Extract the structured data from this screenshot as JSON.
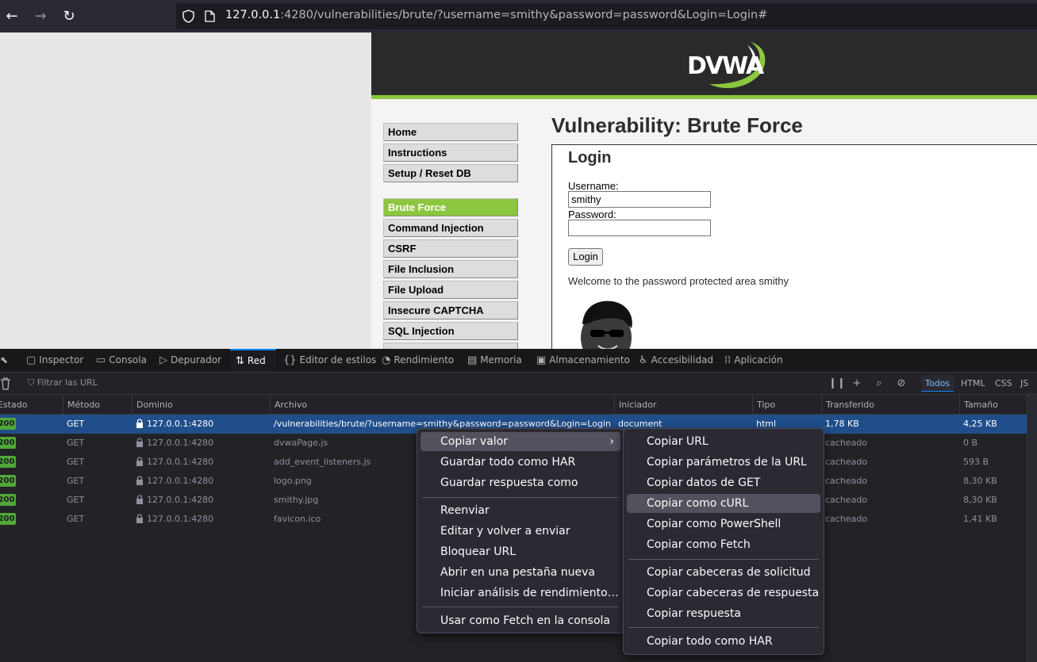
{
  "browser": {
    "url_host": "127.0.0.1",
    "url_rest": ":4280/vulnerabilities/brute/?username=smithy&password=password&Login=Login#"
  },
  "dvwa": {
    "logo_text": "DVWA",
    "menu": [
      "Home",
      "Instructions",
      "Setup / Reset DB",
      "Brute Force",
      "Command Injection",
      "CSRF",
      "File Inclusion",
      "File Upload",
      "Insecure CAPTCHA",
      "SQL Injection"
    ],
    "active_menu": "Brute Force",
    "title": "Vulnerability: Brute Force",
    "login_heading": "Login",
    "username_label": "Username:",
    "username_value": "smithy",
    "password_label": "Password:",
    "password_value": "",
    "login_button": "Login",
    "welcome": "Welcome to the password protected area smithy"
  },
  "devtools": {
    "tabs": [
      "Inspector",
      "Consola",
      "Depurador",
      "Red",
      "Editor de estilos",
      "Rendimiento",
      "Memoria",
      "Almacenamiento",
      "Accesibilidad",
      "Aplicación"
    ],
    "active_tab": "Red",
    "filter_placeholder": "Filtrar las URL",
    "type_filters": [
      "Todos",
      "HTML",
      "CSS",
      "JS"
    ],
    "columns": [
      "Estado",
      "Método",
      "Dominio",
      "Archivo",
      "Iniciador",
      "Tipo",
      "Transferido",
      "Tamaño"
    ],
    "rows": [
      {
        "status": "200",
        "method": "GET",
        "domain": "127.0.0.1:4280",
        "file": "/vulnerabilities/brute/?username=smithy&password=password&Login=Login",
        "initiator": "document",
        "type": "html",
        "transferred": "1,78 KB",
        "size": "4,25 KB"
      },
      {
        "status": "200",
        "method": "GET",
        "domain": "127.0.0.1:4280",
        "file": "dvwaPage.js",
        "initiator": "",
        "type": "",
        "transferred": "cacheado",
        "size": "0 B"
      },
      {
        "status": "200",
        "method": "GET",
        "domain": "127.0.0.1:4280",
        "file": "add_event_listeners.js",
        "initiator": "",
        "type": "",
        "transferred": "cacheado",
        "size": "593 B"
      },
      {
        "status": "200",
        "method": "GET",
        "domain": "127.0.0.1:4280",
        "file": "logo.png",
        "initiator": "",
        "type": "",
        "transferred": "cacheado",
        "size": "8,30 KB"
      },
      {
        "status": "200",
        "method": "GET",
        "domain": "127.0.0.1:4280",
        "file": "smithy.jpg",
        "initiator": "",
        "type": "",
        "transferred": "cacheado",
        "size": "8,30 KB"
      },
      {
        "status": "200",
        "method": "GET",
        "domain": "127.0.0.1:4280",
        "file": "favicon.ico",
        "initiator": "",
        "type": "",
        "transferred": "cacheado",
        "size": "1,41 KB"
      }
    ]
  },
  "context_menu": {
    "items": [
      "Copiar valor",
      "Guardar todo como HAR",
      "Guardar respuesta como",
      "Reenviar",
      "Editar y volver a enviar",
      "Bloquear URL",
      "Abrir en una pestaña nueva",
      "Iniciar análisis de rendimiento…",
      "Usar como Fetch en la consola"
    ]
  },
  "submenu": {
    "items": [
      "Copiar URL",
      "Copiar parámetros de la URL",
      "Copiar datos de GET",
      "Copiar como cURL",
      "Copiar como PowerShell",
      "Copiar como Fetch",
      "Copiar cabeceras de solicitud",
      "Copiar cabeceras de respuesta",
      "Copiar respuesta",
      "Copiar todo como HAR"
    ],
    "highlighted": "Copiar como cURL"
  },
  "colors": {
    "accent": "#8dc63f",
    "selection": "#204e8a",
    "devtools_active": "#0a84ff"
  }
}
